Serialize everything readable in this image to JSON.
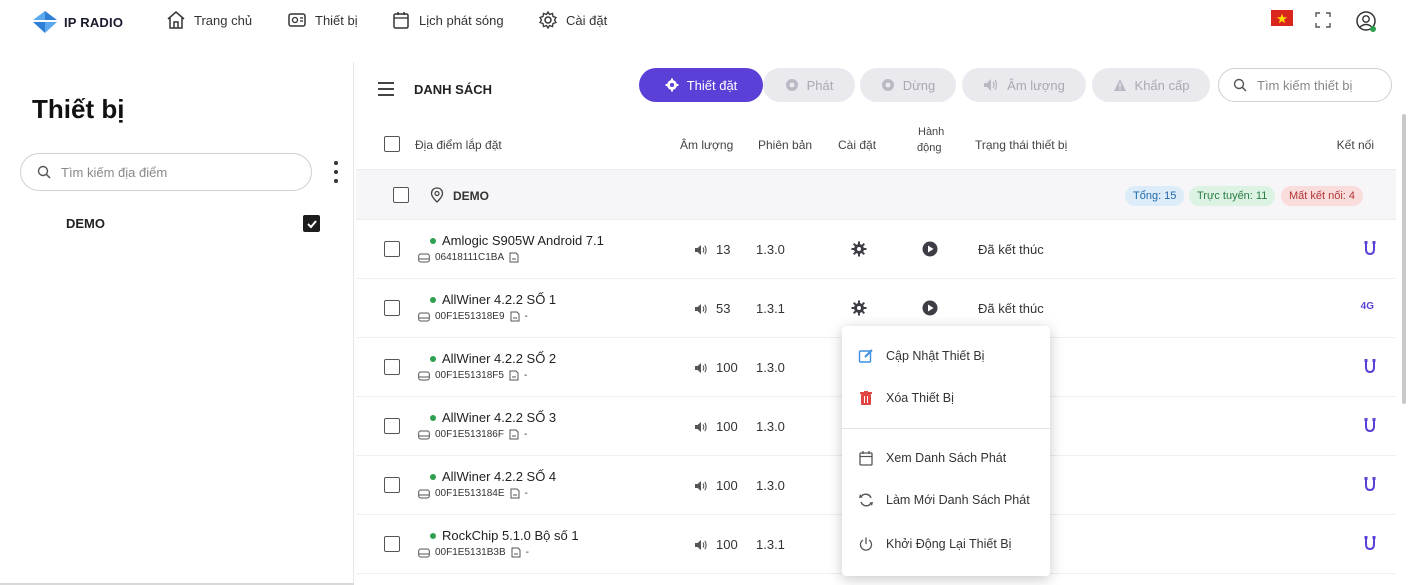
{
  "app": {
    "name": "IP RADIO",
    "nav": [
      {
        "label": "Trang chủ",
        "icon": "home-icon"
      },
      {
        "label": "Thiết bị",
        "icon": "device-icon"
      },
      {
        "label": "Lịch phát sóng",
        "icon": "calendar-icon"
      },
      {
        "label": "Cài đặt",
        "icon": "gear-icon"
      }
    ],
    "language_flag": "vietnam-flag-icon",
    "colors": {
      "accent": "#5b3fd6",
      "online": "#2e9e4f",
      "flag_red": "#da251d",
      "flag_star": "#ffdd00"
    }
  },
  "left": {
    "title": "Thiết bị",
    "search_placeholder": "Tìm kiếm địa điểm",
    "locations": [
      {
        "name": "DEMO",
        "checked": true
      }
    ]
  },
  "toolbar": {
    "title": "DANH SÁCH",
    "buttons": {
      "setup": "Thiết đặt",
      "play": "Phát",
      "stop": "Dừng",
      "volume": "Âm lượng",
      "emergency": "Khẩn cấp"
    },
    "search_placeholder": "Tìm kiếm thiết bị"
  },
  "table": {
    "headers": {
      "location": "Địa điểm lắp đặt",
      "volume": "Âm lượng",
      "version": "Phiên bản",
      "settings": "Cài đặt",
      "action_line1": "Hành",
      "action_line2": "động",
      "status": "Trạng thái thiết bị",
      "connection": "Kết nối"
    },
    "group": {
      "name": "DEMO",
      "total": "Tổng: 15",
      "online": "Trực tuyến: 11",
      "offline": "Mất kết nối: 4"
    },
    "rows": [
      {
        "name": "Amlogic S905W Android 7.1",
        "id": "06418111C1BA",
        "suffix": "",
        "volume": "13",
        "version": "1.3.0",
        "status": "Đã kết thúc",
        "conn": "wired"
      },
      {
        "name": "AllWiner 4.2.2 SỐ 1",
        "id": "00F1E51318E9",
        "suffix": "-",
        "volume": "53",
        "version": "1.3.1",
        "status": "Đã kết thúc",
        "conn": "4G"
      },
      {
        "name": "AllWiner 4.2.2 SỐ 2",
        "id": "00F1E51318F5",
        "suffix": "-",
        "volume": "100",
        "version": "1.3.0",
        "status": "",
        "conn": "wired"
      },
      {
        "name": "AllWiner 4.2.2 SỐ 3",
        "id": "00F1E513186F",
        "suffix": "-",
        "volume": "100",
        "version": "1.3.0",
        "status": "",
        "conn": "wired"
      },
      {
        "name": "AllWiner 4.2.2 SỐ 4",
        "id": "00F1E513184E",
        "suffix": "-",
        "volume": "100",
        "version": "1.3.0",
        "status": "",
        "conn": "wired"
      },
      {
        "name": "RockChip 5.1.0 Bộ số 1",
        "id": "00F1E5131B3B",
        "suffix": "-",
        "volume": "100",
        "version": "1.3.1",
        "status": "",
        "conn": "wired"
      }
    ]
  },
  "context_menu": {
    "items": [
      {
        "label": "Cập Nhật Thiết Bị",
        "icon": "edit-icon"
      },
      {
        "label": "Xóa Thiết Bị",
        "icon": "trash-icon"
      },
      {
        "label": "Xem Danh Sách Phát",
        "icon": "calendar-icon"
      },
      {
        "label": "Làm Mới Danh Sách Phát",
        "icon": "refresh-icon"
      },
      {
        "label": "Khởi Động Lại Thiết Bị",
        "icon": "power-icon"
      }
    ]
  }
}
